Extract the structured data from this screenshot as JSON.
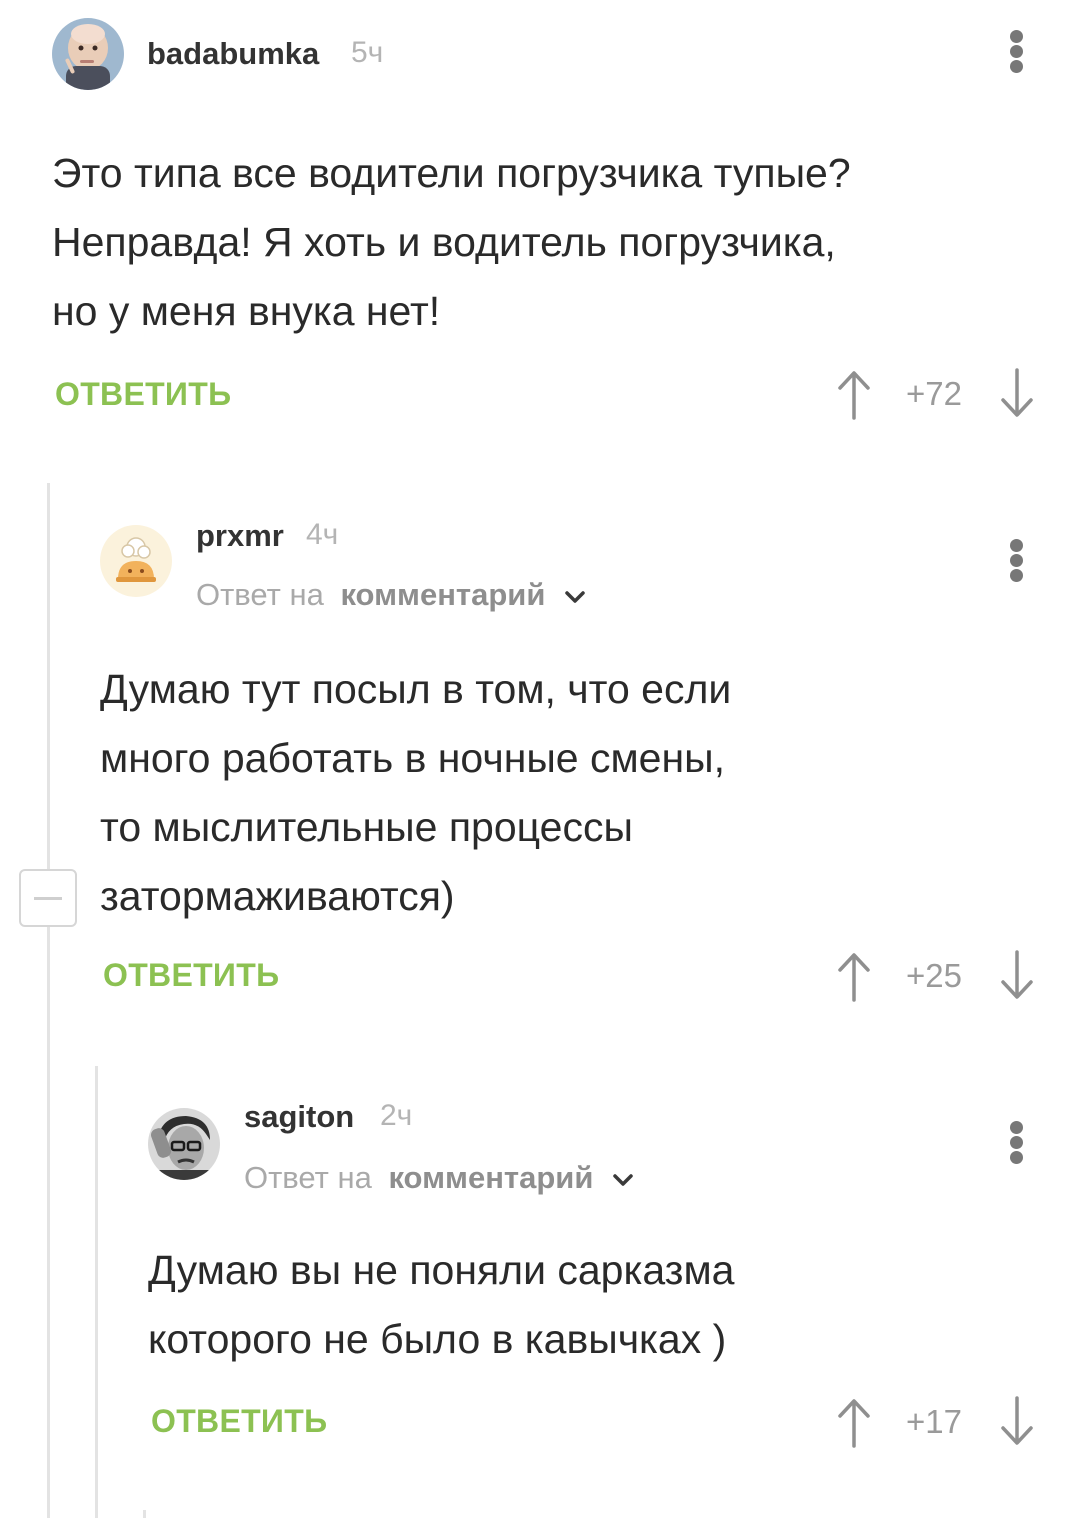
{
  "comments": [
    {
      "username": "badabumka",
      "time": "5ч",
      "reply_to": null,
      "lines": [
        "Это типа все водители погрузчика тупые?",
        "Неправда! Я хоть и водитель погрузчика,",
        "но у меня внука нет!"
      ],
      "reply_label": "ОТВЕТИТЬ",
      "rating": "+72"
    },
    {
      "username": "prxmr",
      "time": "4ч",
      "reply_to": {
        "prefix": "Ответ на",
        "target": "комментарий"
      },
      "lines": [
        "Думаю тут посыл в том, что если",
        "много работать в ночные смены,",
        "то мыслительные процессы",
        "затормаживаются)"
      ],
      "reply_label": "ОТВЕТИТЬ",
      "rating": "+25"
    },
    {
      "username": "sagiton",
      "time": "2ч",
      "reply_to": {
        "prefix": "Ответ на",
        "target": "комментарий"
      },
      "lines": [
        "Думаю вы не поняли сарказма",
        "которого не было в кавычках )"
      ],
      "reply_label": "ОТВЕТИТЬ",
      "rating": "+17"
    }
  ],
  "colors": {
    "accent_green": "#8cc152",
    "text": "#2a2a2a",
    "muted": "#a9a9a9",
    "thread_line": "#e3e3e3"
  },
  "icons": [
    "more-vertical-icon",
    "upvote-arrow-icon",
    "downvote-arrow-icon",
    "chevron-down-icon",
    "collapse-minus-icon"
  ]
}
